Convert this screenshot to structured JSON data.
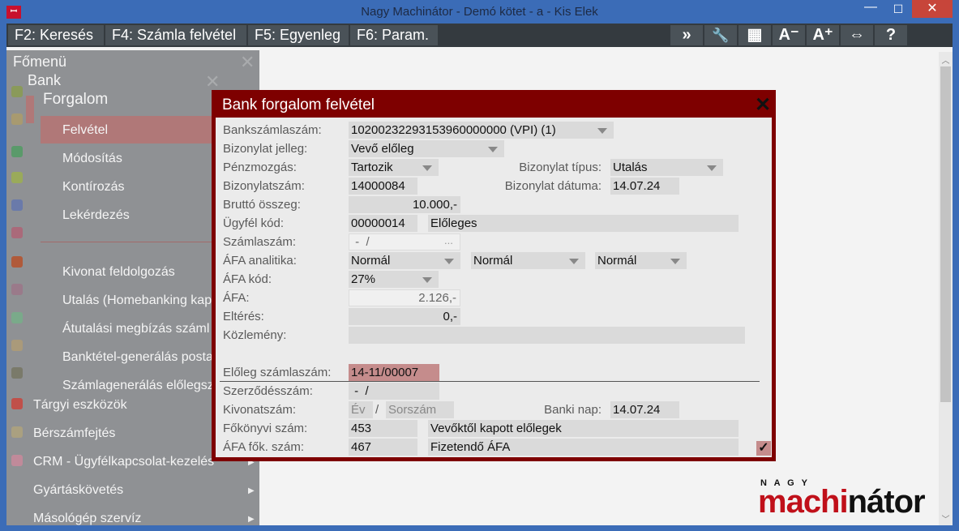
{
  "window": {
    "title": "Nagy Machinátor - Demó kötet - a - Kis Elek",
    "app_icon": "ꟷꟷ",
    "minimize": "—",
    "maximize": "☐",
    "close": "✕"
  },
  "toolbar": {
    "buttons": [
      "F2: Keresés",
      "F4: Számla felvétel",
      "F5: Egyenleg",
      "F6: Param."
    ],
    "icons": [
      {
        "name": "forward-icon",
        "glyph": "»"
      },
      {
        "name": "wrench-icon",
        "glyph": "🔧"
      },
      {
        "name": "grid-icon",
        "glyph": "▦"
      },
      {
        "name": "font-decrease-icon",
        "glyph": "A⁻"
      },
      {
        "name": "font-increase-icon",
        "glyph": "A⁺"
      },
      {
        "name": "resize-icon",
        "glyph": "⇔"
      },
      {
        "name": "help-icon",
        "glyph": "?"
      }
    ]
  },
  "sidebar": {
    "root": "Főmenü",
    "bank": "Bank",
    "forgalom": "Forgalom",
    "sub": [
      "Felvétel",
      "Módosítás",
      "Kontírozás",
      "Lekérdezés"
    ],
    "bank_items": [
      "Kivonat feldolgozás",
      "Utalás (Homebanking kap",
      "Átutalási megbízás száml",
      "Banktétel-generálás posta",
      "Számlagenerálás előlegsz"
    ],
    "modules": [
      "Tárgyi eszközök",
      "Bérszámfejtés",
      "CRM - Ügyfélkapcsolat-kezelés",
      "Gyártáskövetés",
      "Másológép szervíz"
    ]
  },
  "dialog": {
    "title": "Bank forgalom felvétel",
    "close": "✕",
    "labels": {
      "bankszamla": "Bankszámlaszám:",
      "jelleg": "Bizonylat jelleg:",
      "penzmozgas": "Pénzmozgás:",
      "tipus": "Bizonylat típus:",
      "bizonylatszam": "Bizonylatszám:",
      "datum": "Bizonylat dátuma:",
      "brutto": "Bruttó összeg:",
      "ugyfel": "Ügyfél kód:",
      "szamlaszam": "Számlaszám:",
      "afa_analitika": "ÁFA analitika:",
      "afa_kod": "ÁFA kód:",
      "afa": "ÁFA:",
      "elteres": "Eltérés:",
      "kozlemeny": "Közlemény:",
      "eloleg": "Előleg számlaszám:",
      "szerzodes": "Szerződésszám:",
      "kivonat": "Kivonatszám:",
      "banki_nap": "Banki nap:",
      "fokonyvi": "Főkönyvi szám:",
      "afa_fok": "ÁFA fők. szám:"
    },
    "values": {
      "bankszamla": "10200232293153960000000 (VPI) (1)",
      "jelleg": "Vevő előleg",
      "penzmozgas": "Tartozik",
      "tipus": "Utalás",
      "bizonylatszam": "14000084",
      "datum": "14.07.24",
      "brutto": "10.000,-",
      "ugyfel_kod": "00000014",
      "ugyfel_nev": "Előleges",
      "szamlaszam": " -  /",
      "szamlaszam_more": "...",
      "afa_analitika": [
        "Normál",
        "Normál",
        "Normál"
      ],
      "afa_kod": "27%",
      "afa": "2.126,-",
      "elteres": "0,-",
      "kozlemeny": "",
      "eloleg": "14-11/00007",
      "szerzodes": " -  /",
      "kivonat_ev": "Év",
      "kivonat_sep": "/",
      "kivonat_sorszam": "Sorszám",
      "banki_nap": "14.07.24",
      "fokonyvi": "453",
      "fokonyvi_nev": "Vevőktől kapott előlegek",
      "afa_fok": "467",
      "afa_fok_nev": "Fizetendő ÁFA",
      "ok": "✓"
    }
  },
  "logo": {
    "top": "N A G Y",
    "red": "machi",
    "black": "nátor"
  }
}
